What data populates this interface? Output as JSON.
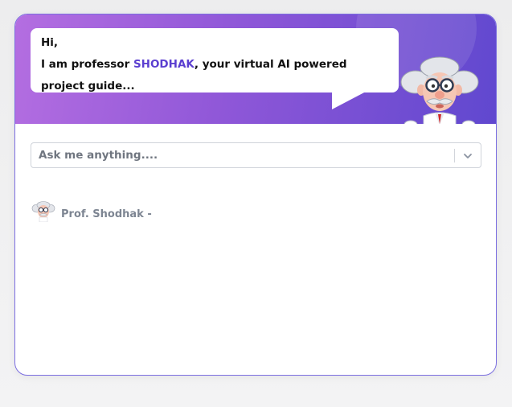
{
  "greeting": {
    "line1": "Hi,",
    "line2_prefix": "I am professor ",
    "brand": "SHODHAK",
    "line2_suffix": ", your virtual AI powered",
    "line3": "project guide..."
  },
  "search": {
    "placeholder": "Ask me anything...."
  },
  "message": {
    "sender": "Prof. Shodhak -"
  },
  "colors": {
    "accent": "#5b3fd0",
    "hero_start": "#b46ee1",
    "hero_end": "#6048cf",
    "card_border": "#7b6ee0"
  },
  "icons": {
    "professor": "professor-illustration",
    "dropdown": "chevron-down-icon",
    "avatar": "professor-avatar-icon"
  }
}
